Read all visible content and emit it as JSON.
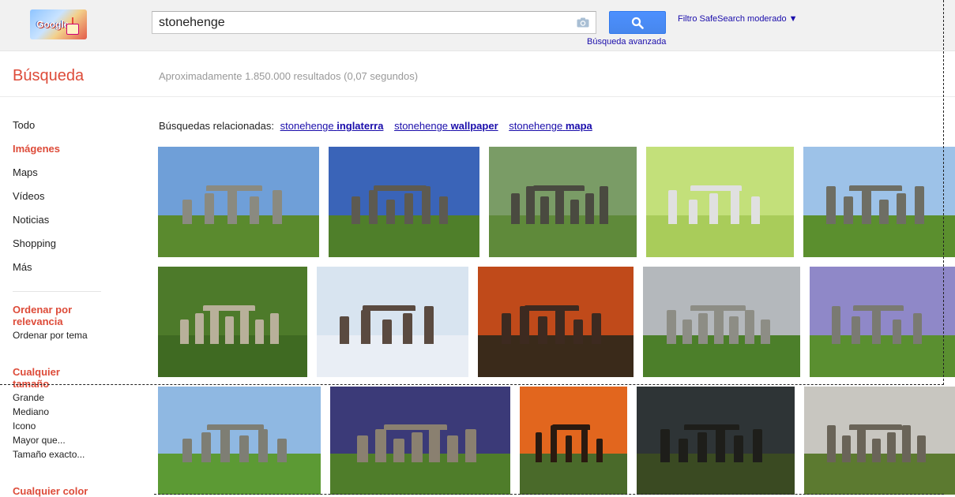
{
  "header": {
    "logo_text": "Google",
    "search_value": "stonehenge",
    "search_button_icon": "magnifier-icon",
    "advanced_search_label": "Búsqueda avanzada",
    "safesearch_label": "Filtro SafeSearch moderado ▼"
  },
  "subheader": {
    "title": "Búsqueda",
    "result_stats": "Aproximadamente 1.850.000 resultados (0,07 segundos)"
  },
  "nav": {
    "items": [
      {
        "label": "Todo",
        "active": false
      },
      {
        "label": "Imágenes",
        "active": true
      },
      {
        "label": "Maps",
        "active": false
      },
      {
        "label": "Vídeos",
        "active": false
      },
      {
        "label": "Noticias",
        "active": false
      },
      {
        "label": "Shopping",
        "active": false
      },
      {
        "label": "Más",
        "active": false
      }
    ],
    "sort_heading": "Ordenar por relevancia",
    "sort_option": "Ordenar por tema",
    "size_heading": "Cualquier tamaño",
    "size_options": [
      "Grande",
      "Mediano",
      "Icono",
      "Mayor que...",
      "Tamaño exacto..."
    ],
    "color_heading": "Cualquier color"
  },
  "related": {
    "prefix": "Búsquedas relacionadas:",
    "links": [
      {
        "base": "stonehenge",
        "bold": "inglaterra"
      },
      {
        "base": "stonehenge",
        "bold": "wallpaper"
      },
      {
        "base": "stonehenge",
        "bold": "mapa"
      }
    ]
  },
  "image_results": [
    {
      "name": "stonehenge-blue-sky-clouds",
      "sky": "#6f9fd8",
      "ground": "#5a8a2e",
      "stone": "#8a8a80"
    },
    {
      "name": "stonehenge-deep-blue-sky",
      "sky": "#3a64b8",
      "ground": "#4f7f2a",
      "stone": "#5d5a50"
    },
    {
      "name": "stonehenge-aerial-render",
      "sky": "#7a9c66",
      "ground": "#5f8a3a",
      "stone": "#4a4a40"
    },
    {
      "name": "stonehenge-diagram",
      "sky": "#c3e07a",
      "ground": "#a9cc5a",
      "stone": "#e0e0e0"
    },
    {
      "name": "stonehenge-close-trilithons",
      "sky": "#9dc2e8",
      "ground": "#5b8f2e",
      "stone": "#6e6e64"
    },
    {
      "name": "stonehenge-aerial-field",
      "sky": "#4d7a2a",
      "ground": "#3f6a22",
      "stone": "#b8b09a"
    },
    {
      "name": "stonehenge-snow",
      "sky": "#d8e4f0",
      "ground": "#e9eef5",
      "stone": "#5a4a40"
    },
    {
      "name": "stonehenge-red-sunset",
      "sky": "#c04a1a",
      "ground": "#3a2a1a",
      "stone": "#3d2a20"
    },
    {
      "name": "stonehenge-grey-sky",
      "sky": "#b4b8bc",
      "ground": "#4c7f2a",
      "stone": "#8d8d85"
    },
    {
      "name": "stonehenge-purple-sky",
      "sky": "#8f88c8",
      "ground": "#5a8f30",
      "stone": "#7a7a72"
    },
    {
      "name": "stonehenge-tourists",
      "sky": "#8fb8e2",
      "ground": "#5c9a34",
      "stone": "#7e7e74"
    },
    {
      "name": "stonehenge-night-moon",
      "sky": "#3b3a78",
      "ground": "#4f7d2a",
      "stone": "#8a8070"
    },
    {
      "name": "stonehenge-orange-sunset",
      "sky": "#e2661e",
      "ground": "#4a6a2a",
      "stone": "#2a1a10"
    },
    {
      "name": "stonehenge-storm-clouds",
      "sky": "#2e3436",
      "ground": "#3a4a22",
      "stone": "#1e1e1a"
    },
    {
      "name": "stonehenge-evening-field",
      "sky": "#c8c6c0",
      "ground": "#5c7a30",
      "stone": "#6a6458"
    }
  ]
}
